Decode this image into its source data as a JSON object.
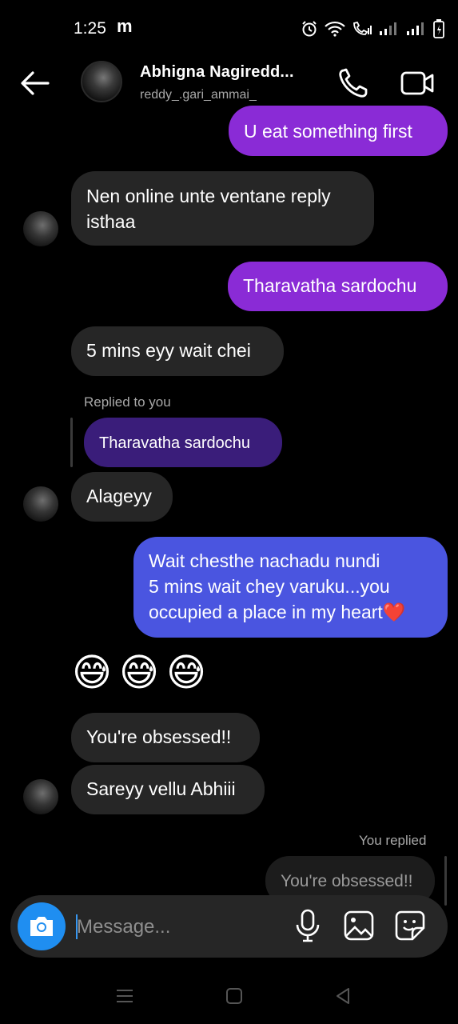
{
  "status_bar": {
    "time": "1:25",
    "notification_letter": "m"
  },
  "header": {
    "name": "Abhigna Nagiredd...",
    "username": "reddy_.gari_ammai_"
  },
  "messages": {
    "m1": "U eat something first",
    "m2": "Nen online unte ventane reply isthaa",
    "m3": "Tharavatha sardochu",
    "m4": "5 mins eyy wait chei",
    "reply_label": "Replied to you",
    "reply_quote": "Tharavatha sardochu",
    "m5": "Alageyy",
    "m6_line1": "Wait chesthe nachadu nundi",
    "m6_line2": "5 mins wait chey varuku...you",
    "m6_line3": "occupied a place in my heart",
    "m6_emoji": "❤️",
    "m7_emojis": [
      "😅",
      "😅",
      "😅"
    ],
    "m8": "You're obsessed!!",
    "m9": "Sareyy vellu Abhiii",
    "you_replied_label": "You replied",
    "you_replied_quote": "You're obsessed!!"
  },
  "composer": {
    "placeholder": "Message..."
  },
  "colors": {
    "incoming": "#262626",
    "outgoing_purple": "#8a2bd6",
    "outgoing_blue": "#4a55e0",
    "accent": "#1f8ef1"
  }
}
